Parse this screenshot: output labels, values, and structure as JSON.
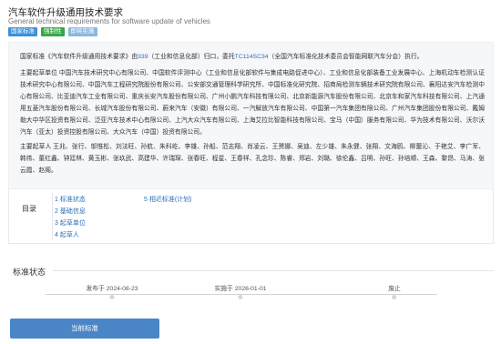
{
  "header": {
    "title_cn": "汽车软件升级通用技术要求",
    "title_en": "General technical requirements for software update of vehicles",
    "tags": [
      "国家标准",
      "强制性",
      "即将实施"
    ]
  },
  "intro": {
    "p1_prefix": "国家标准《汽车软件升级通用技术要求》由",
    "p1_num": "339",
    "p1_mid": "（工业和信息化部）归口，委托",
    "p1_tc": "TC114SC34",
    "p1_suffix": "（全国汽车标准化技术委员会智能网联汽车分会）执行。",
    "p2": "主要起草单位 中国汽车技术研究中心有限公司、中国软件评测中心（工业和信息化部软件与集成电路促进中心）、工业和信息化部装备工业发展中心、上海机动车检测认证技术研究中心有限公司、中国汽车工程研究院股份有限公司、公安部交通管理科学研究所、中国标准化研究院、招商局检测车辆技术研究院有限公司、襄阳达安汽车检测中心有限公司、比亚迪汽车工业有限公司、重庆长安汽车股份有限公司、广州小鹏汽车科技有限公司、北京新能源汽车股份有限公司、北京车和家汽车科技有限公司、上汽通用五菱汽车股份有限公司、长城汽车股份有限公司、蔚来汽车（安徽）有限公司、一汽解放汽车有限公司、中国第一汽车集团有限公司、广州汽车集团股份有限公司、戴姆勒大中华区投资有限公司、泛亚汽车技术中心有限公司、上汽大众汽车有限公司、上海艾拉比智能科技有限公司、宝马（中国）服务有限公司、华为技术有限公司、沃尔沃汽车（亚太）投资控股有限公司、大众汽车（中国）投资有限公司。",
    "p3": "主要起草人 王兆、张行、邬惟松、刘法旺、孙航、朱科屹、李雄、孙船、范志翔、肖凌云、王赟娜、吴迪、左少雄、朱永健、张翔、文海鸥、柳蕾沁、于艳艾、李广军、韩伟、董红鑫、钟廷林、黄玉彬、张玖武、高建华、许瑞琛、张春旺、程星、王春祥、孔念珍、陈睿、郑岩、刘璐、徐伦鑫、吕明、孙旺、孙培顺、王森、黎昂、马涛、张云霞、赵阁。"
  },
  "toc": {
    "label": "目录",
    "items": [
      "1  标准状态",
      "2  基础信息",
      "3  起草单位",
      "4  起草人"
    ],
    "items2": [
      "5  相近标准(计划)"
    ]
  },
  "status": {
    "section_title": "标准状态",
    "timeline": [
      {
        "label": "发布于 2024-08-23"
      },
      {
        "label": "实施于 2026-01-01"
      },
      {
        "label": "废止"
      }
    ],
    "current_button": "当前标准"
  },
  "colors": {
    "accent": "#2c6fb8",
    "tag_national": "#3f8fd6",
    "tag_mandatory": "#3aa64a",
    "tag_upcoming": "#8ab7de",
    "button": "#4a86c6"
  }
}
